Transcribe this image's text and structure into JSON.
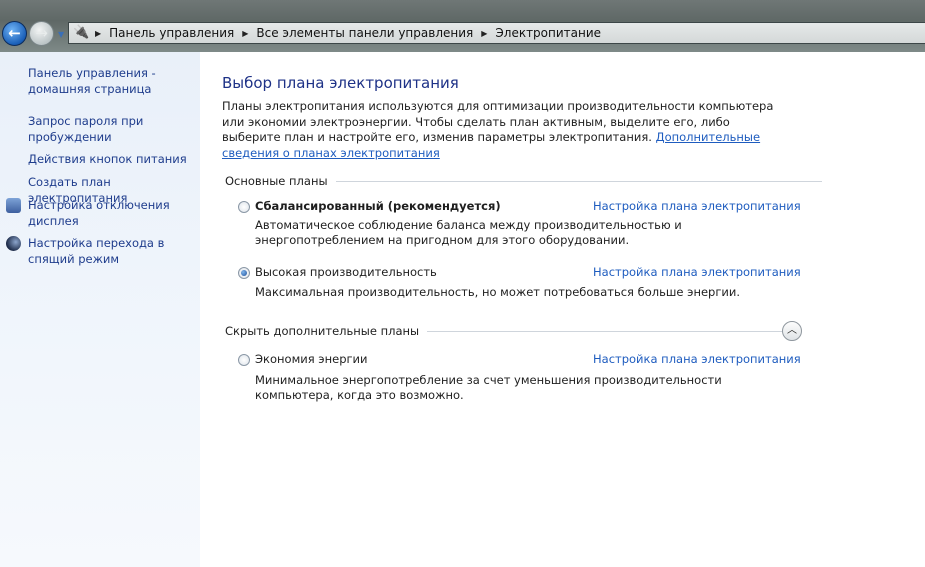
{
  "address_bar": {
    "crumbs": [
      "Панель управления",
      "Все элементы панели управления",
      "Электропитание"
    ]
  },
  "sidebar": {
    "items": [
      {
        "label": "Панель управления - домашняя страница",
        "icon": null
      },
      {
        "label": "Запрос пароля при пробуждении",
        "icon": null
      },
      {
        "label": "Действия кнопок питания",
        "icon": null
      },
      {
        "label": "Создать план электропитания",
        "icon": null
      },
      {
        "label": "Настройка отключения дисплея",
        "icon": "display-clock-icon"
      },
      {
        "label": "Настройка перехода в спящий режим",
        "icon": "moon-icon"
      }
    ]
  },
  "main": {
    "title": "Выбор плана электропитания",
    "intro": "Планы электропитания используются для оптимизации производительности компьютера или экономии электроэнергии. Чтобы сделать план активным, выделите его, либо выберите план и настройте его, изменив параметры электропитания.",
    "intro_link": "Дополнительные сведения о планах электропитания",
    "basic_section": "Основные планы",
    "hidden_section": "Скрыть дополнительные планы",
    "plan_link": "Настройка плана электропитания",
    "plans": [
      {
        "name": "Сбалансированный (рекомендуется)",
        "desc": "Автоматическое соблюдение баланса между производительностью и энергопотреблением на пригодном для этого оборудовании.",
        "selected": false
      },
      {
        "name": "Высокая производительность",
        "desc": "Максимальная производительность, но может потребоваться больше энергии.",
        "selected": true
      },
      {
        "name": "Экономия энергии",
        "desc": "Минимальное энергопотребление за счет уменьшения производительности компьютера, когда это возможно.",
        "selected": false
      }
    ]
  }
}
